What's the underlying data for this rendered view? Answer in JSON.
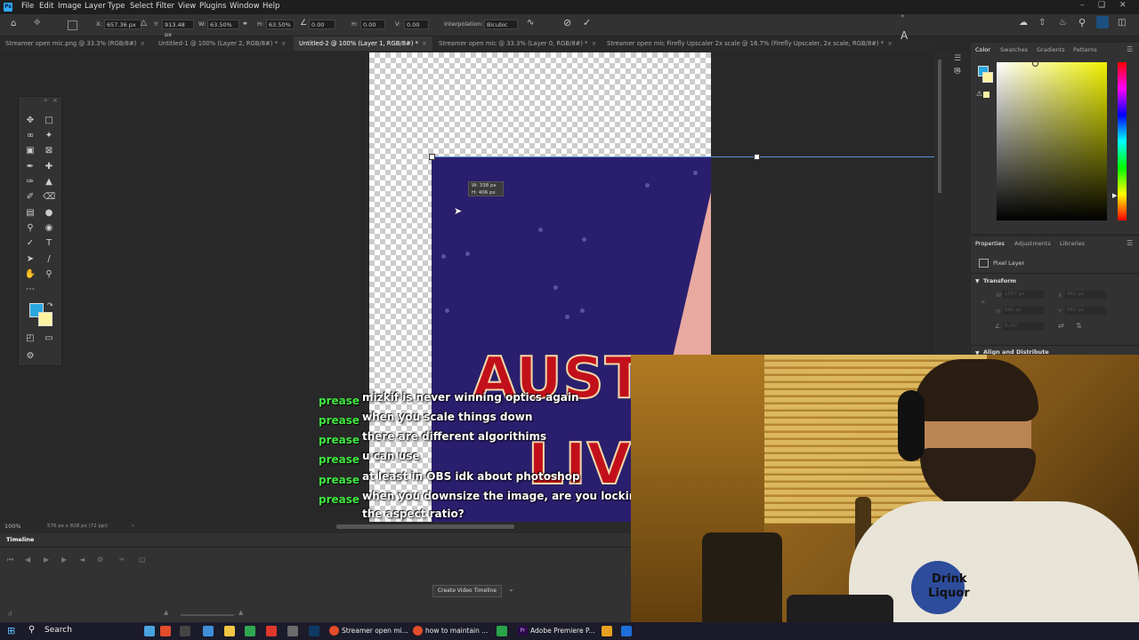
{
  "menubar": {
    "logo": "Ps",
    "items": [
      "File",
      "Edit",
      "Image",
      "Layer",
      "Type",
      "Select",
      "Filter",
      "View",
      "Plugins",
      "Window",
      "Help"
    ]
  },
  "options": {
    "x_label": "X:",
    "x_value": "657.36 px",
    "y_label": "Y:",
    "y_value": "913.48 px",
    "w_label": "W:",
    "w_value": "63.50%",
    "h_label": "H:",
    "h_value": "63.50%",
    "angle_value": "0.00",
    "hskew_label": "H:",
    "hskew_value": "0.00",
    "vskew_label": "V:",
    "vskew_value": "0.00",
    "interp_label": "Interpolation:",
    "interp_value": "Bicubic"
  },
  "tabs": [
    {
      "label": "Streamer open mic.png @ 33.3% (RGB/8#)",
      "active": false
    },
    {
      "label": "Untitled-1 @ 100% (Layer 2, RGB/8#) *",
      "active": false
    },
    {
      "label": "Untitled-2 @ 100% (Layer 1, RGB/8#) *",
      "active": true
    },
    {
      "label": "Streamer open mic @ 33.3% (Layer 0, RGB/8#) *",
      "active": false
    },
    {
      "label": "Streamer open mic Firefly Upscaler 2x scale @ 16.7% (Firefly Upscaler, 2x scale, RGB/8#) *",
      "active": false
    }
  ],
  "size_tooltip": {
    "line1": "W: 338 px",
    "line2": "H: 406 px"
  },
  "poster": {
    "line1": "AUSTI",
    "line2": "LIVI"
  },
  "color_panel": {
    "tabs": [
      "Color",
      "Swatches",
      "Gradients",
      "Patterns"
    ]
  },
  "properties_panel": {
    "tabs": [
      "Properties",
      "Adjustments",
      "Libraries"
    ],
    "layer_type": "Pixel Layer",
    "transform_header": "Transform",
    "w_label": "W",
    "w_value": "1057 px",
    "x_label": "X",
    "x_value": "441 px",
    "h_label": "H",
    "h_value": "592 px",
    "y_label": "Y",
    "y_value": "582 px",
    "angle_value": "0.00°",
    "align_header": "Align and Distribute"
  },
  "status": {
    "zoom": "100%",
    "doc_info": "576 px x 828 px (72 ppi)"
  },
  "timeline": {
    "title": "Timeline",
    "create_button": "Create Video Timeline"
  },
  "chat": [
    {
      "user": "prease",
      "message": "mizkif is never winning optics again"
    },
    {
      "user": "prease",
      "message": "when you scale things down"
    },
    {
      "user": "prease",
      "message": "there are different algorithims"
    },
    {
      "user": "prease",
      "message": "u can use"
    },
    {
      "user": "prease",
      "message": "at least in OBS idk about photoshop"
    },
    {
      "user": "prease",
      "message": "when you downsize the image, are you locking"
    },
    {
      "user": "",
      "message": "the aspect ratio?"
    }
  ],
  "webcam": {
    "shirt_text_1": "Drink",
    "shirt_text_2": "Liquor"
  },
  "taskbar": {
    "search": "Search",
    "apps": [
      "Streamer open mi...",
      "how to maintain ...",
      "Adobe Premiere P..."
    ]
  },
  "colors": {
    "foreground": "#29a8e0",
    "background": "#fdf3a0",
    "accent": "#31a8ff"
  }
}
